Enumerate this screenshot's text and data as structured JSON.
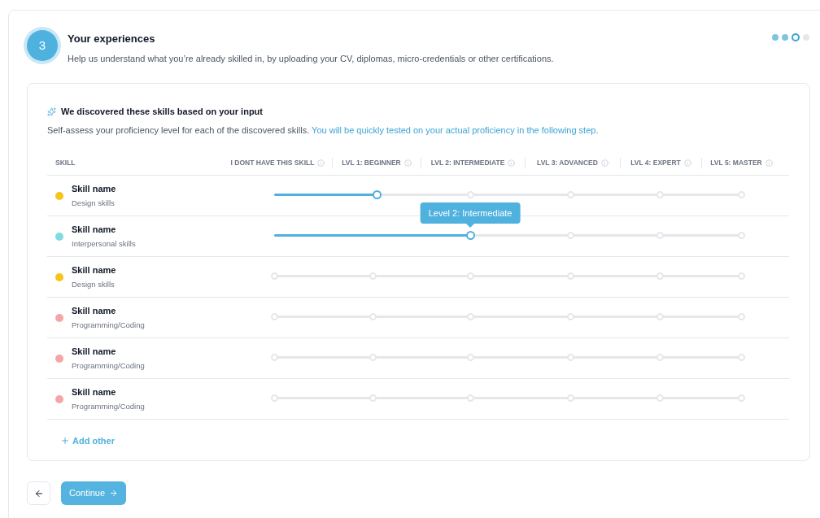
{
  "step": {
    "number": "3",
    "title": "Your experiences",
    "description": "Help us understand what you’re already skilled in, by uploading your CV, diplomas, micro-credentials or other certifications."
  },
  "progress": [
    {
      "done": true,
      "current": false
    },
    {
      "done": true,
      "current": false
    },
    {
      "done": false,
      "current": true
    },
    {
      "done": false,
      "current": false
    }
  ],
  "skills_panel": {
    "title": "We discovered these skills based on your input",
    "description": "Self-assess your proficiency level for each of the discovered skills.",
    "highlight": "You will be quickly tested on your actual proficiency in the following step.",
    "columns": [
      {
        "label": "SKILL"
      },
      {
        "label": "I DONT HAVE THIS SKILL",
        "info": true
      },
      {
        "label": "LVL 1: BEGINNER",
        "info": true
      },
      {
        "label": "LVL 2: INTERMEDIATE",
        "info": true
      },
      {
        "label": "LVL 3: ADVANCED",
        "info": true
      },
      {
        "label": "LVL 4: EXPERT",
        "info": true
      },
      {
        "label": "LVL 5: MASTER",
        "info": true
      }
    ],
    "rows": [
      {
        "name": "Skill name",
        "category": "Design skills",
        "color": "#f5c518",
        "level": 0.22
      },
      {
        "name": "Skill name",
        "category": "Interpersonal skills",
        "color": "#7fdbe0",
        "level": 0.42,
        "tooltip": "Level 2: Intermediate"
      },
      {
        "name": "Skill name",
        "category": "Design skills",
        "color": "#f5c518"
      },
      {
        "name": "Skill name",
        "category": "Programming/Coding",
        "color": "#f4a6a6"
      },
      {
        "name": "Skill name",
        "category": "Programming/Coding",
        "color": "#f4a6a6"
      },
      {
        "name": "Skill name",
        "category": "Programming/Coding",
        "color": "#f4a6a6"
      }
    ],
    "add_label": "Add other"
  },
  "continue_label": "Continue"
}
